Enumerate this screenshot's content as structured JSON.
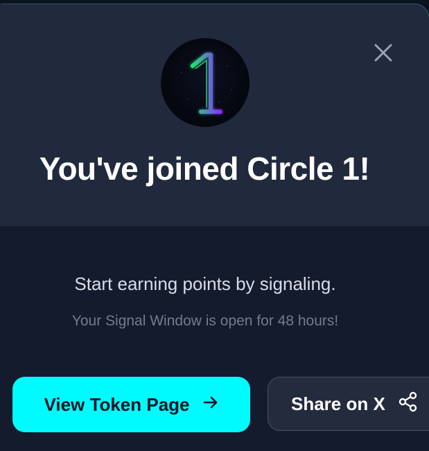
{
  "modal": {
    "badge_icon": "circle-one-neon-badge",
    "close_icon": "close-icon",
    "title": "You've joined Circle 1!",
    "subtitle": "Start earning points by signaling.",
    "note": "Your Signal Window is open for 48 hours!"
  },
  "actions": {
    "primary_label": "View Token Page",
    "primary_icon": "arrow-right-icon",
    "secondary_label": "Share on X",
    "secondary_icon": "share-icon"
  },
  "colors": {
    "accent": "#00fbff",
    "header_bg": "#212a3d",
    "body_bg": "#141b2d"
  }
}
